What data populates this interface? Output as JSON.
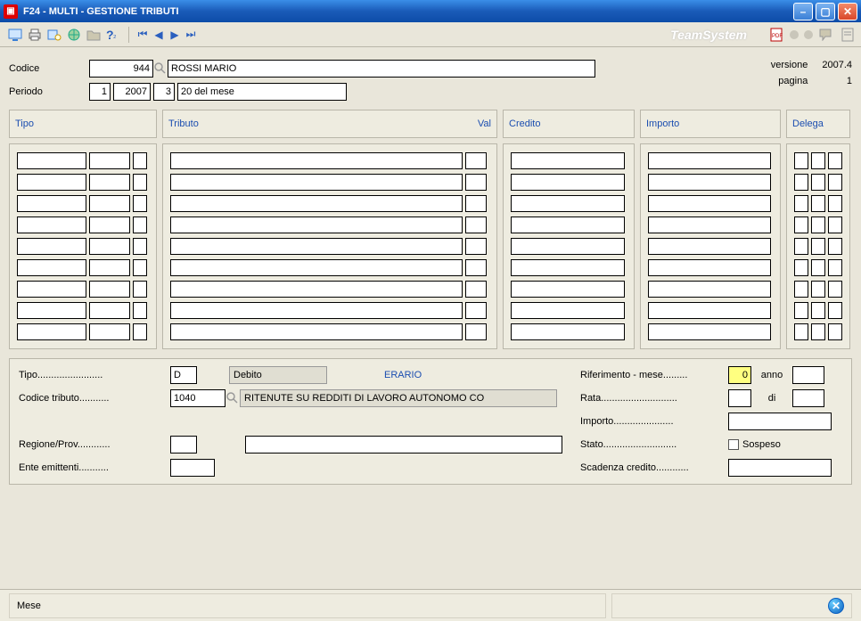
{
  "title": "F24  -  MULTI -   GESTIONE TRIBUTI",
  "brand": "TeamSystem",
  "header": {
    "codice_label": "Codice",
    "codice_value": "944",
    "nome": "ROSSI MARIO",
    "periodo_label": "Periodo",
    "periodo_a": "1",
    "periodo_b": "2007",
    "periodo_c": "3",
    "periodo_desc": "20 del mese",
    "versione_label": "versione",
    "versione_value": "2007.4",
    "pagina_label": "pagina",
    "pagina_value": "1"
  },
  "columns": {
    "tipo": "Tipo",
    "tributo": "Tributo",
    "val": "Val",
    "credito": "Credito",
    "importo": "Importo",
    "delega": "Delega"
  },
  "detail": {
    "tipo_label": "Tipo........................",
    "tipo_value": "D",
    "tipo_desc": "Debito",
    "sezione": "ERARIO",
    "codtrib_label": "Codice tributo...........",
    "codtrib_value": "1040",
    "codtrib_desc": "RITENUTE SU REDDITI DI LAVORO AUTONOMO CO",
    "regione_label": "Regione/Prov............",
    "ente_label": "Ente emittenti...........",
    "rif_label": "Riferimento - mese.........",
    "rif_mese": "0",
    "anno_label": "anno",
    "rata_label": "Rata............................",
    "di_label": "di",
    "importo_label": "Importo......................",
    "stato_label": "Stato...........................",
    "sospeso_label": "Sospeso",
    "scad_label": "Scadenza credito............"
  },
  "status": {
    "left": "Mese"
  }
}
